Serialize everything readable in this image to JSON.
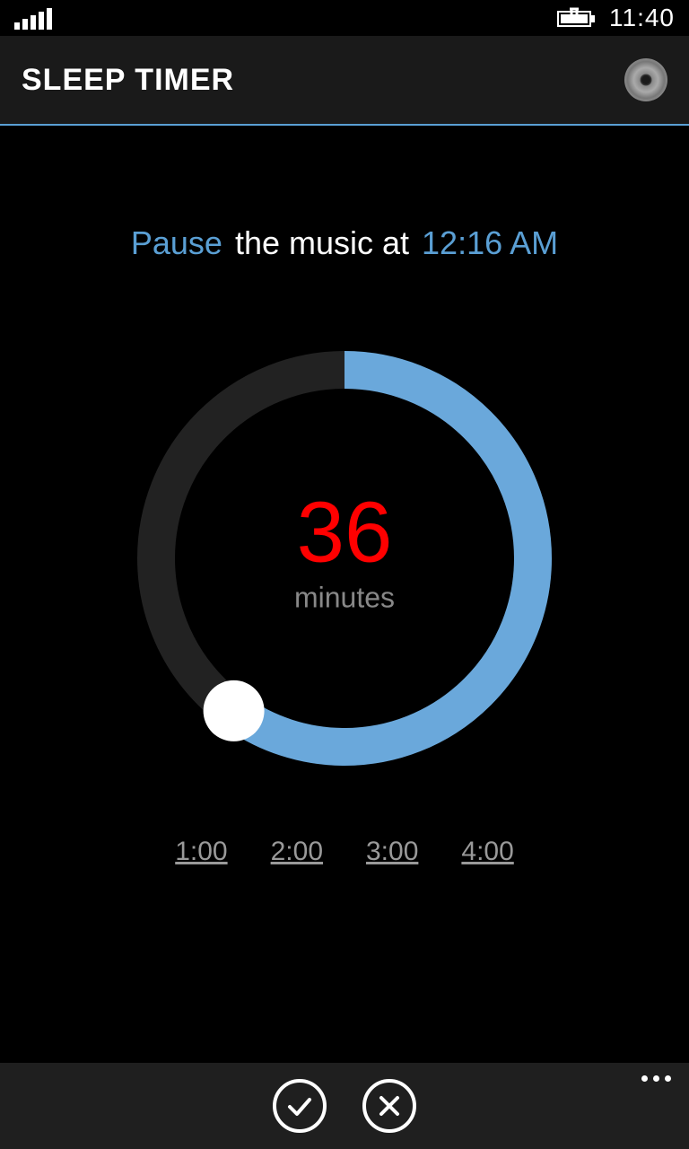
{
  "status": {
    "time": "11:40"
  },
  "header": {
    "title": "SLEEP TIMER"
  },
  "sentence": {
    "action": "Pause",
    "mid": "the music at",
    "time": "12:16 AM"
  },
  "dial": {
    "value": "36",
    "unit": "minutes",
    "progress_fraction": 0.6
  },
  "presets": [
    "1:00",
    "2:00",
    "3:00",
    "4:00"
  ],
  "colors": {
    "accent": "#5a9fd4",
    "danger": "#ff0000"
  }
}
